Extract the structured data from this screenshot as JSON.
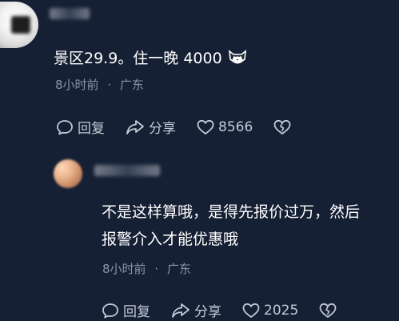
{
  "top_comment": {
    "text": "景区29.9。住一晚 4000",
    "emoji": "cat-face-emoji",
    "time": "8小时前",
    "separator": "·",
    "location": "广东",
    "reply_label": "回复",
    "share_label": "分享",
    "like_count": "8566"
  },
  "reply_comment": {
    "text_line1": "不是这样算哦，是得先报价过万，然后",
    "text_line2": "报警介入才能优惠哦",
    "time": "8小时前",
    "separator": "·",
    "location": "广东",
    "reply_label": "回复",
    "share_label": "分享",
    "like_count": "2025"
  },
  "colors": {
    "background": "#152034",
    "meta": "#8b95a8",
    "action": "#c3c9d5"
  }
}
